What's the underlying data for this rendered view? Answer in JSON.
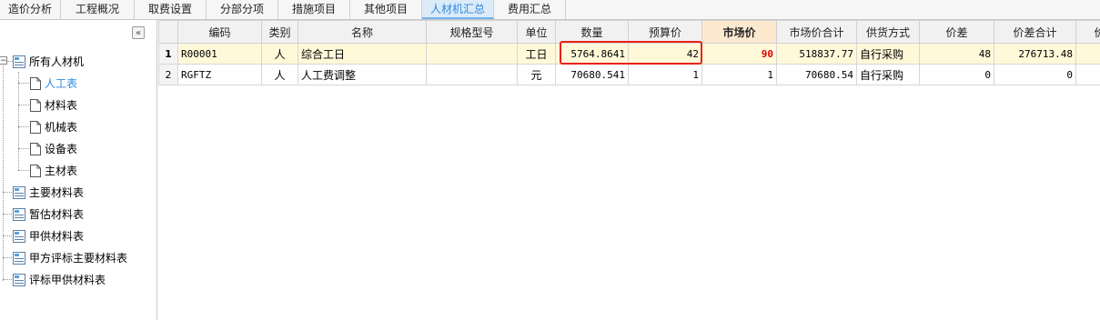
{
  "tabs": [
    {
      "label": "造价分析",
      "active": false
    },
    {
      "label": "工程概况",
      "active": false
    },
    {
      "label": "取费设置",
      "active": false
    },
    {
      "label": "分部分项",
      "active": false
    },
    {
      "label": "措施项目",
      "active": false
    },
    {
      "label": "其他项目",
      "active": false
    },
    {
      "label": "人材机汇总",
      "active": true
    },
    {
      "label": "费用汇总",
      "active": false
    }
  ],
  "sidebar": {
    "collapse_glyph": "«",
    "root": {
      "label": "所有人材机"
    },
    "children": [
      {
        "label": "人工表",
        "selected": true
      },
      {
        "label": "材料表"
      },
      {
        "label": "机械表"
      },
      {
        "label": "设备表"
      },
      {
        "label": "主材表"
      }
    ],
    "top_level": [
      {
        "label": "主要材料表"
      },
      {
        "label": "暂估材料表"
      },
      {
        "label": "甲供材料表"
      },
      {
        "label": "甲方评标主要材料表"
      },
      {
        "label": "评标甲供材料表"
      }
    ]
  },
  "table": {
    "columns": [
      "编码",
      "类别",
      "名称",
      "规格型号",
      "单位",
      "数量",
      "预算价",
      "市场价",
      "市场价合计",
      "供货方式",
      "价差",
      "价差合计",
      "价"
    ],
    "highlight_column": "市场价",
    "rows": [
      {
        "idx": "1",
        "code": "R00001",
        "type": "人",
        "name": "综合工日",
        "spec": "",
        "unit": "工日",
        "qty": "5764.8641",
        "budget": "42",
        "market": "90",
        "market_total": "518837.77",
        "supply": "自行采购",
        "diff": "48",
        "diff_total": "276713.48"
      },
      {
        "idx": "2",
        "code": "RGFTZ",
        "type": "人",
        "name": "人工费调整",
        "spec": "",
        "unit": "元",
        "qty": "70680.541",
        "budget": "1",
        "market": "1",
        "market_total": "70680.54",
        "supply": "自行采购",
        "diff": "0",
        "diff_total": "0"
      }
    ]
  },
  "colors": {
    "accent": "#2d8ae0",
    "highlight_header": "#fde9d0",
    "selected_row": "#fff9d9",
    "annotation": "#e8221d",
    "market_value": "#e00000"
  }
}
